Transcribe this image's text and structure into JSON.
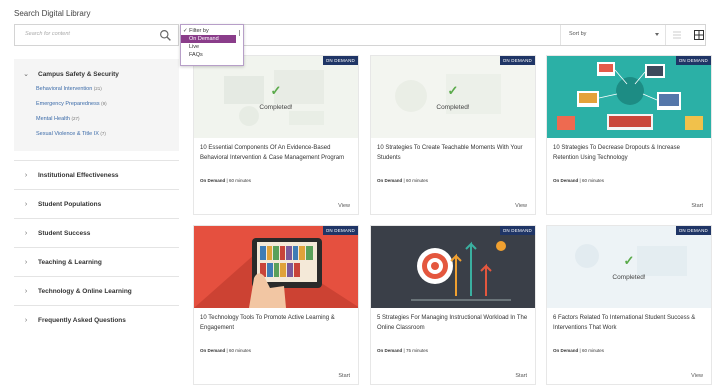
{
  "page": {
    "title": "Search Digital Library"
  },
  "search": {
    "placeholder": "Search for content"
  },
  "filter": {
    "header": "✓ Filter by",
    "options": [
      "On Demand",
      "Live",
      "FAQs"
    ],
    "selected": "On Demand"
  },
  "sort": {
    "label": "Sort by"
  },
  "sidebar": {
    "expanded": {
      "label": "Campus Safety & Security",
      "items": [
        {
          "label": "Behavioral Intervention",
          "count": "(21)"
        },
        {
          "label": "Emergency Preparedness",
          "count": "(9)"
        },
        {
          "label": "Mental Health",
          "count": "(27)"
        },
        {
          "label": "Sexual Violence & Title IX",
          "count": "(7)"
        }
      ]
    },
    "categories": [
      "Institutional Effectiveness",
      "Student Populations",
      "Student Success",
      "Teaching & Learning",
      "Technology & Online Learning",
      "Frequently Asked Questions"
    ]
  },
  "cards": [
    {
      "badge": "ON DEMAND",
      "completed": true,
      "completed_text": "Completed!",
      "title": "10 Essential Components Of An Evidence-Based Behavioral Intervention & Case Management Program",
      "meta_type": "On Demand",
      "meta_duration": "| 60 minutes",
      "action": "View"
    },
    {
      "badge": "ON DEMAND",
      "completed": true,
      "completed_text": "Completed!",
      "title": "10 Strategies To Create Teachable Moments With Your Students",
      "meta_type": "On Demand",
      "meta_duration": "| 60 minutes",
      "action": "View"
    },
    {
      "badge": "ON DEMAND",
      "completed": false,
      "title": "10 Strategies To Decrease Dropouts & Increase Retention Using Technology",
      "meta_type": "On Demand",
      "meta_duration": "| 60 minutes",
      "action": "Start"
    },
    {
      "badge": "ON DEMAND",
      "completed": false,
      "title": "10 Technology Tools To Promote Active Learning & Engagement",
      "meta_type": "On Demand",
      "meta_duration": "| 60 minutes",
      "action": "Start"
    },
    {
      "badge": "ON DEMAND",
      "completed": false,
      "title": "5 Strategies For Managing Instructional Workload In The Online Classroom",
      "meta_type": "On Demand",
      "meta_duration": "| 75 minutes",
      "action": "Start"
    },
    {
      "badge": "ON DEMAND",
      "completed": true,
      "completed_text": "Completed!",
      "title": "6 Factors Related To International Student Success & Interventions That Work",
      "meta_type": "On Demand",
      "meta_duration": "| 60 minutes",
      "action": "View"
    }
  ],
  "colors": {
    "badge": "#1f3566",
    "accent_purple": "#8a3d8a",
    "link": "#3a6aa8",
    "check": "#5aaa4a"
  }
}
